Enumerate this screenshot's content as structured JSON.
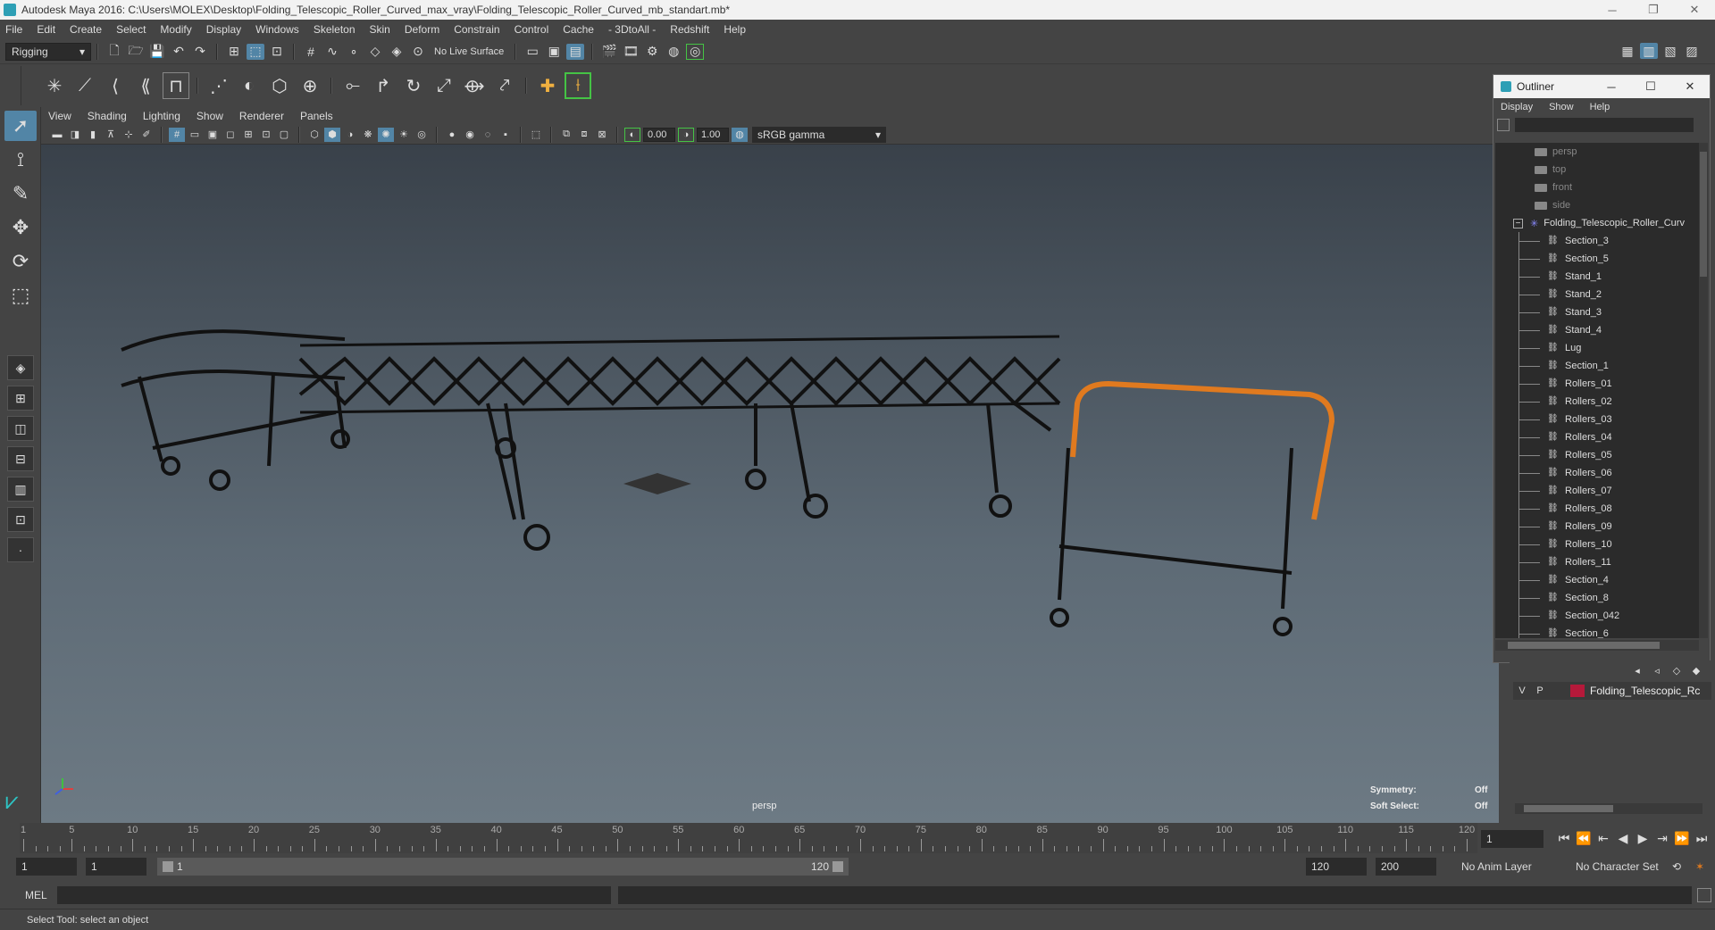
{
  "window": {
    "title": "Autodesk Maya 2016: C:\\Users\\MOLEX\\Desktop\\Folding_Telescopic_Roller_Curved_max_vray\\Folding_Telescopic_Roller_Curved_mb_standart.mb*",
    "minimize": "─",
    "restore": "❐",
    "close": "✕"
  },
  "menubar": [
    "File",
    "Edit",
    "Create",
    "Select",
    "Modify",
    "Display",
    "Windows",
    "Skeleton",
    "Skin",
    "Deform",
    "Constrain",
    "Control",
    "Cache",
    "- 3DtoAll -",
    "Redshift",
    "Help"
  ],
  "statusline": {
    "mode": "Rigging",
    "live_surface": "No Live Surface"
  },
  "panel": {
    "menus": [
      "View",
      "Shading",
      "Lighting",
      "Show",
      "Renderer",
      "Panels"
    ],
    "exposure": "0.00",
    "gamma": "1.00",
    "color_management": "sRGB gamma"
  },
  "viewport": {
    "camera_label": "persp",
    "hud": {
      "symmetry_label": "Symmetry:",
      "symmetry_value": "Off",
      "soft_select_label": "Soft Select:",
      "soft_select_value": "Off"
    }
  },
  "outliner": {
    "title": "Outliner",
    "menus": [
      "Display",
      "Show",
      "Help"
    ],
    "cameras": [
      "persp",
      "top",
      "front",
      "side"
    ],
    "root": "Folding_Telescopic_Roller_Curv",
    "children": [
      "Section_3",
      "Section_5",
      "Stand_1",
      "Stand_2",
      "Stand_3",
      "Stand_4",
      "Lug",
      "Section_1",
      "Rollers_01",
      "Rollers_02",
      "Rollers_03",
      "Rollers_04",
      "Rollers_05",
      "Rollers_06",
      "Rollers_07",
      "Rollers_08",
      "Rollers_09",
      "Rollers_10",
      "Rollers_11",
      "Section_4",
      "Section_8",
      "Section_042",
      "Section_6"
    ]
  },
  "layer_editor": {
    "visibility": "V",
    "playback": "P",
    "layer_name": "Folding_Telescopic_Rc",
    "layer_color": "#b5193a"
  },
  "timeline": {
    "tick_labels": [
      "1",
      "5",
      "10",
      "15",
      "20",
      "25",
      "30",
      "35",
      "40",
      "45",
      "50",
      "55",
      "60",
      "65",
      "70",
      "75",
      "80",
      "85",
      "90",
      "95",
      "100",
      "105",
      "110",
      "115",
      "120"
    ],
    "current_frame": "1"
  },
  "range": {
    "start_field": "1",
    "playback_start": "1",
    "range_start_label": "1",
    "range_end_label": "120",
    "playback_end": "120",
    "end_field": "200",
    "anim_layer": "No Anim Layer",
    "character_set": "No Character Set"
  },
  "cmdline": {
    "language": "MEL"
  },
  "helpline": {
    "text": "Select Tool: select an object"
  },
  "colors": {
    "accent": "#5285a6",
    "highlight_orange": "#e07a1f",
    "shelf_green": "#45c345"
  }
}
